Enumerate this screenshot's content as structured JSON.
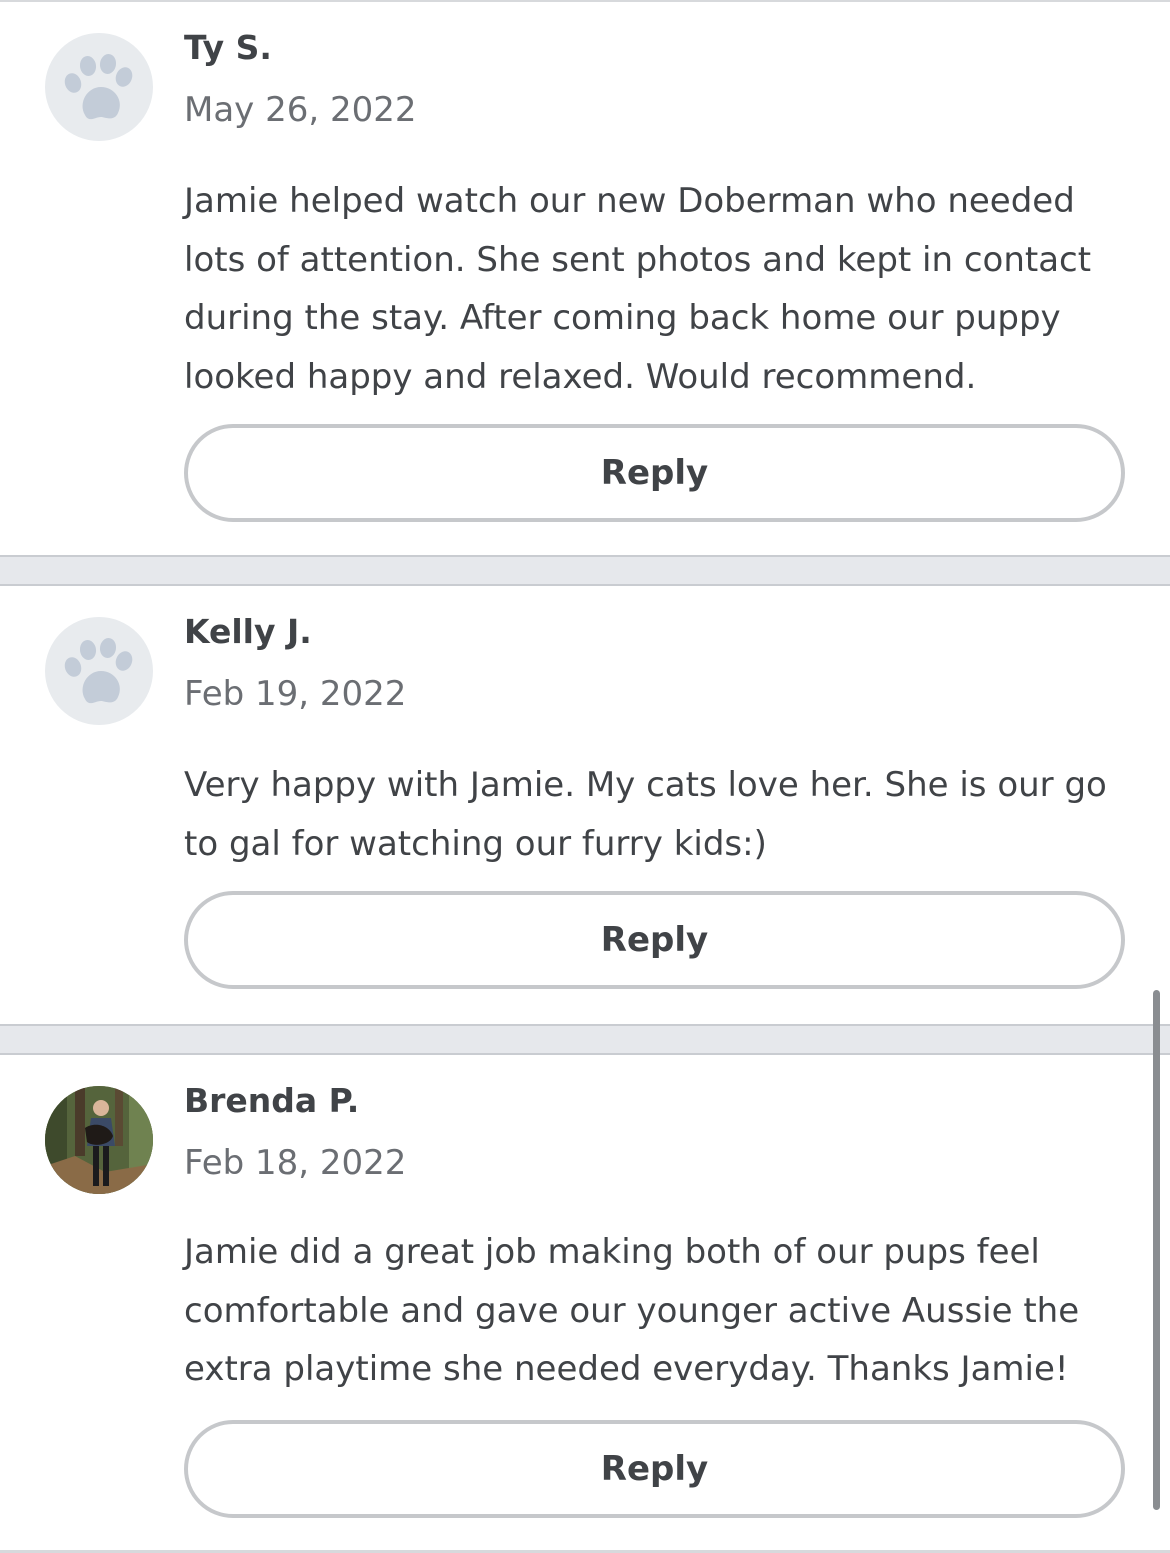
{
  "reviews": [
    {
      "name": "Ty S.",
      "date": "May 26, 2022",
      "text": "Jamie helped watch our new Doberman who needed lots of attention. She sent photos and kept in contact during the stay. After coming back home our puppy looked happy and relaxed. Would recommend.",
      "reply_label": "Reply",
      "avatar": "paw-icon"
    },
    {
      "name": "Kelly J.",
      "date": "Feb 19, 2022",
      "text": "Very happy with Jamie. My cats love her. She is our go to gal for watching our furry kids:)",
      "reply_label": "Reply",
      "avatar": "paw-icon"
    },
    {
      "name": "Brenda P.",
      "date": "Feb 18, 2022",
      "text": "Jamie did a great job making both of our pups feel comfortable and gave our younger active Aussie the extra playtime she needed everyday. Thanks Jamie!",
      "reply_label": "Reply",
      "avatar": "profile-photo"
    }
  ],
  "colors": {
    "paw": "#c3ccd8",
    "avatar_bg": "#e8ebee",
    "separator": "#e6e8ec",
    "button_border": "#c6c8cb",
    "text": "#404347",
    "muted": "#6b6e73"
  }
}
